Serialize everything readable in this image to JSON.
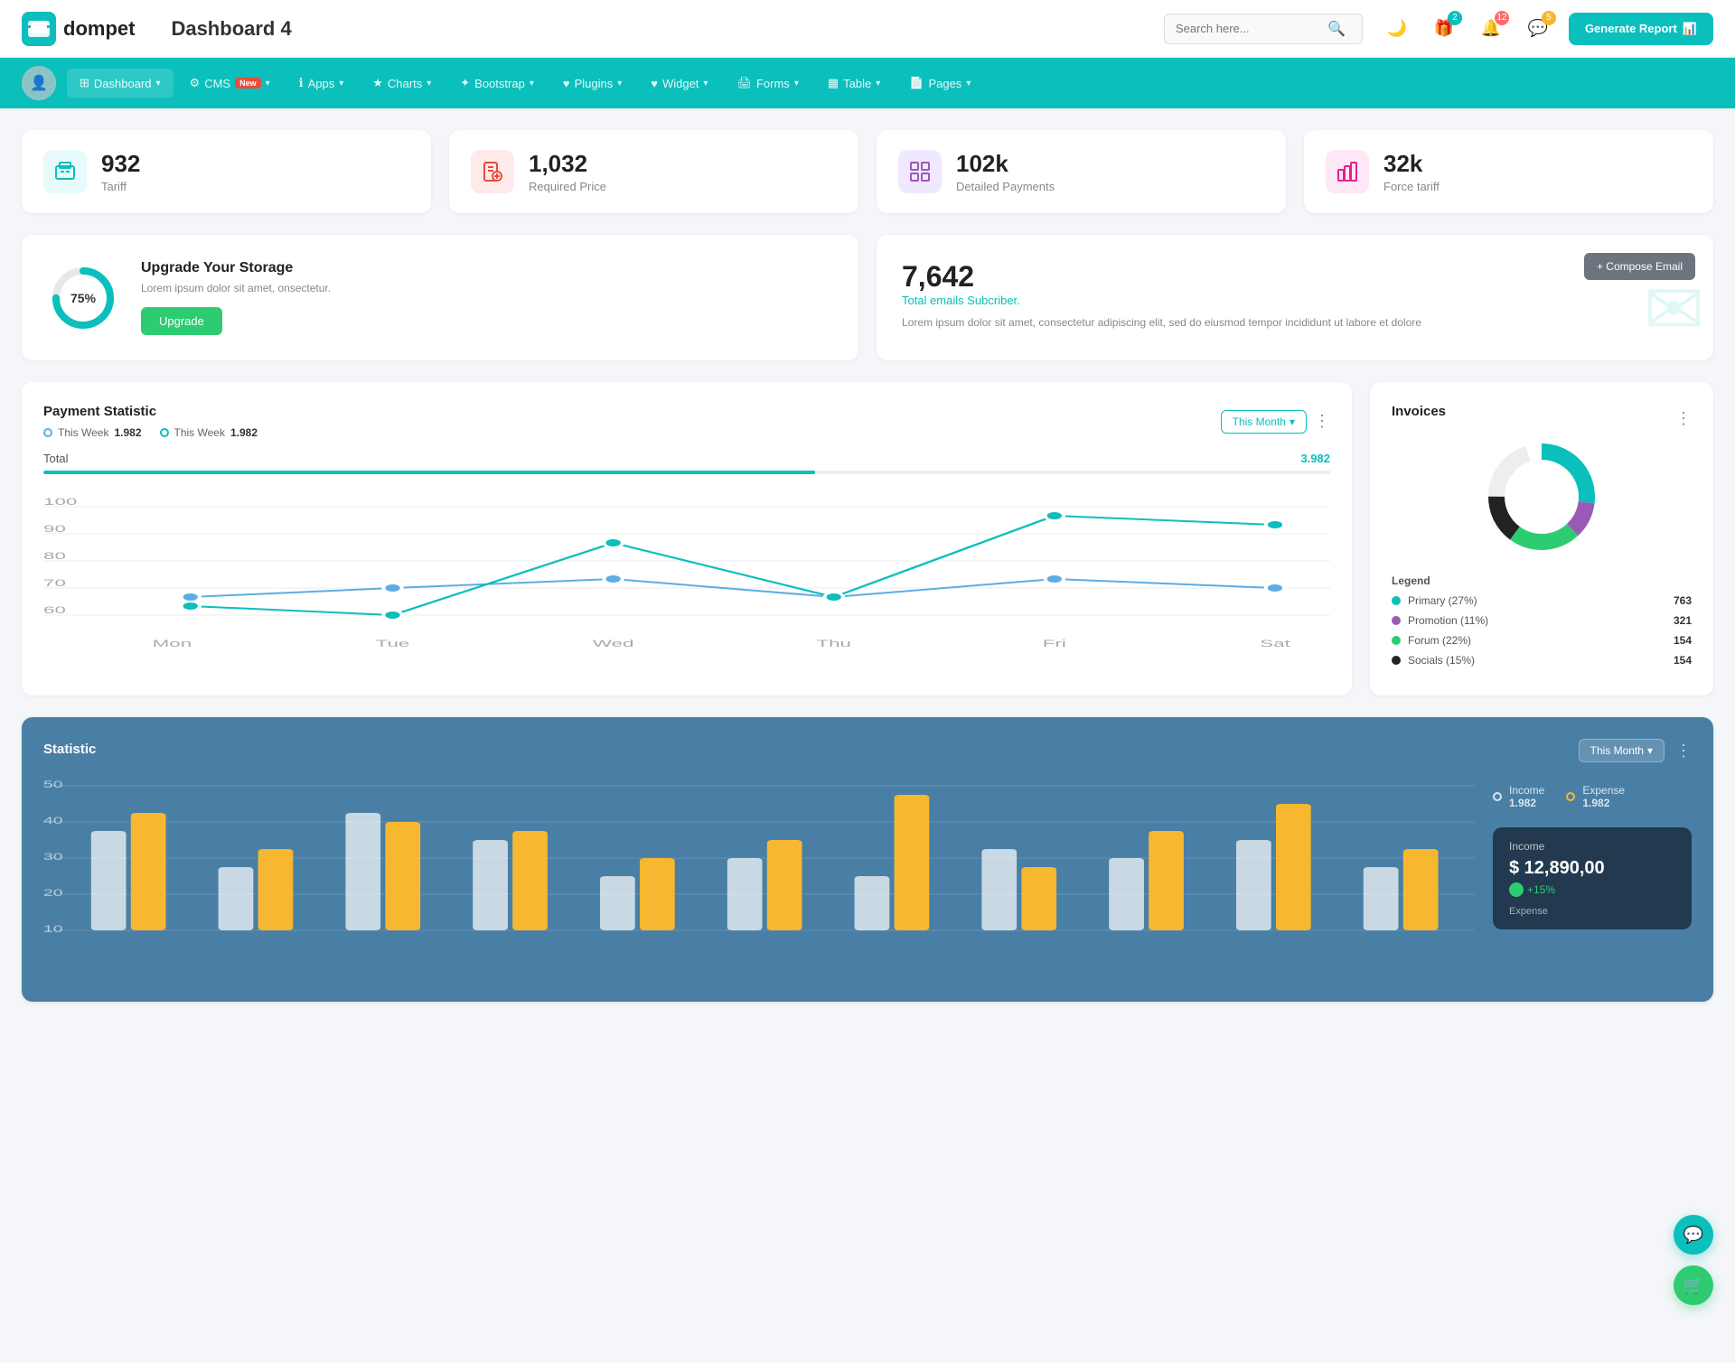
{
  "header": {
    "logo_text": "dompet",
    "title": "Dashboard 4",
    "search_placeholder": "Search here...",
    "generate_btn": "Generate Report",
    "icons": {
      "gift_badge": "2",
      "bell_badge": "12",
      "chat_badge": "5"
    }
  },
  "nav": {
    "items": [
      {
        "label": "Dashboard",
        "icon": "⊞",
        "active": true
      },
      {
        "label": "CMS",
        "icon": "⚙",
        "badge": "New"
      },
      {
        "label": "Apps",
        "icon": "ℹ"
      },
      {
        "label": "Charts",
        "icon": "★"
      },
      {
        "label": "Bootstrap",
        "icon": "✦"
      },
      {
        "label": "Plugins",
        "icon": "♥"
      },
      {
        "label": "Widget",
        "icon": "♥"
      },
      {
        "label": "Forms",
        "icon": "🖨"
      },
      {
        "label": "Table",
        "icon": "▦"
      },
      {
        "label": "Pages",
        "icon": "📄"
      }
    ]
  },
  "stats": [
    {
      "value": "932",
      "label": "Tariff",
      "icon": "briefcase",
      "color": "teal"
    },
    {
      "value": "1,032",
      "label": "Required Price",
      "icon": "file-plus",
      "color": "red"
    },
    {
      "value": "102k",
      "label": "Detailed Payments",
      "icon": "grid",
      "color": "purple"
    },
    {
      "value": "32k",
      "label": "Force tariff",
      "icon": "building",
      "color": "pink"
    }
  ],
  "storage": {
    "percentage": "75%",
    "title": "Upgrade Your Storage",
    "description": "Lorem ipsum dolor sit amet, onsectetur.",
    "button": "Upgrade"
  },
  "email": {
    "count": "7,642",
    "subtitle": "Total emails Subcriber.",
    "description": "Lorem ipsum dolor sit amet, consectetur adipiscing elit, sed do eiusmod tempor incididunt ut labore et dolore",
    "compose_btn": "+ Compose Email"
  },
  "payment": {
    "title": "Payment Statistic",
    "legend1_label": "This Week",
    "legend1_value": "1.982",
    "legend2_label": "This Week",
    "legend2_value": "1.982",
    "filter": "This Month",
    "total_label": "Total",
    "total_value": "3.982",
    "x_labels": [
      "Mon",
      "Tue",
      "Wed",
      "Thu",
      "Fri",
      "Sat"
    ]
  },
  "invoices": {
    "title": "Invoices",
    "legend": [
      {
        "label": "Primary (27%)",
        "value": "763",
        "color": "#0abfbc"
      },
      {
        "label": "Promotion (11%)",
        "value": "321",
        "color": "#9b59b6"
      },
      {
        "label": "Forum (22%)",
        "value": "154",
        "color": "#2ecc71"
      },
      {
        "label": "Socials (15%)",
        "value": "154",
        "color": "#222"
      }
    ]
  },
  "statistic": {
    "title": "Statistic",
    "filter": "This Month",
    "y_labels": [
      "50",
      "40",
      "30",
      "20",
      "10"
    ],
    "legend": {
      "income_label": "Income",
      "income_value": "1.982",
      "expense_label": "Expense",
      "expense_value": "1.982"
    },
    "income_tooltip": {
      "label": "Income",
      "amount": "$ 12,890,00",
      "change": "+15%"
    },
    "expense_label": "Expense"
  }
}
